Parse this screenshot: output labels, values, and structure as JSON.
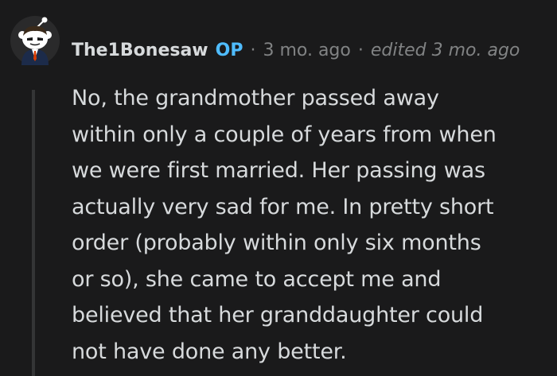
{
  "comment": {
    "author": "The1Bonesaw",
    "badge": "OP",
    "separator": "·",
    "timestamp": "3 mo. ago",
    "edited": "edited 3 mo. ago",
    "body_lines": [
      "No, the grandmother passed away",
      "within only a couple of years from when",
      "we were first married. Her passing was",
      "actually very sad for me. In pretty short",
      "order (probably within only six months",
      "or so), she came to accept me and",
      "believed that her granddaughter could",
      "not have done any better."
    ]
  },
  "avatar": {
    "icon": "snoo-avatar-icon",
    "colors": {
      "background": "#2a2a2b",
      "face": "#ffffff",
      "suit": "#1c2b4a",
      "tie": "#d93a00",
      "hair": "#3a2a1a"
    }
  },
  "colors": {
    "page_background": "#1a1a1b",
    "text": "#d7dadc",
    "meta": "#818384",
    "op_badge": "#4fbcff",
    "thread_line": "#343536"
  }
}
